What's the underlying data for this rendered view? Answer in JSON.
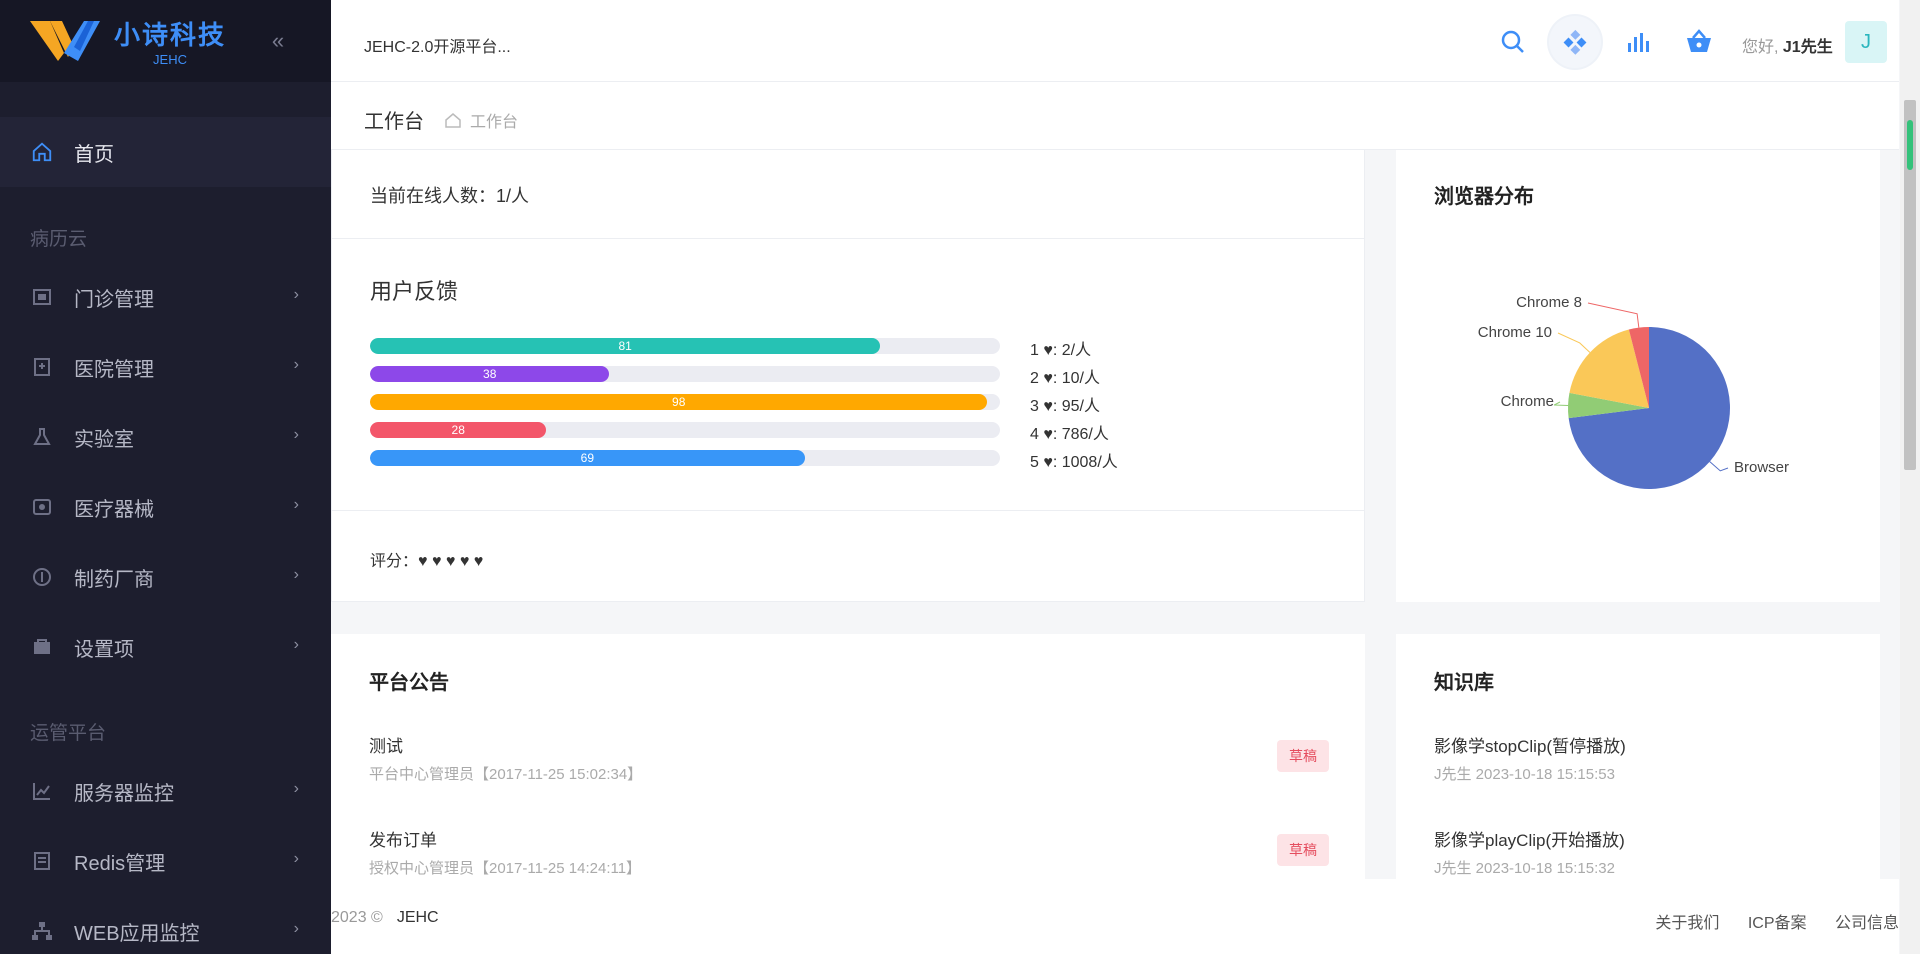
{
  "sidebar": {
    "brand_name": "小诗科技",
    "brand_sub": "JEHC",
    "home_label": "首页",
    "group1": "病历云",
    "group2": "运管平台",
    "items": [
      {
        "label": "门诊管理",
        "icon": "outpatient-icon"
      },
      {
        "label": "医院管理",
        "icon": "hospital-icon"
      },
      {
        "label": "实验室",
        "icon": "lab-icon"
      },
      {
        "label": "医疗器械",
        "icon": "device-icon"
      },
      {
        "label": "制药厂商",
        "icon": "pharma-icon"
      },
      {
        "label": "设置项",
        "icon": "settings-icon"
      },
      {
        "label": "服务器监控",
        "icon": "server-monitor-icon"
      },
      {
        "label": "Redis管理",
        "icon": "redis-icon"
      },
      {
        "label": "WEB应用监控",
        "icon": "web-monitor-icon"
      }
    ]
  },
  "header": {
    "title": "JEHC-2.0开源平台...",
    "greeting": "您好,",
    "user": "J1先生",
    "avatar_letter": "J"
  },
  "breadcrumb": {
    "page_title": "工作台",
    "crumb": "工作台"
  },
  "stats": {
    "online": "当前在线人数：1/人",
    "feedback_title": "用户反馈",
    "bars": [
      {
        "value": 81,
        "label": "1 ♥: 2/人",
        "color": "#26c2b4"
      },
      {
        "value": 38,
        "label": "2 ♥: 10/人",
        "color": "#8d48e9"
      },
      {
        "value": 98,
        "label": "3 ♥: 95/人",
        "color": "#ffa800"
      },
      {
        "value": 28,
        "label": "4 ♥: 786/人",
        "color": "#f3566a"
      },
      {
        "value": 69,
        "label": "5 ♥: 1008/人",
        "color": "#3896f8"
      }
    ],
    "rating": "评分：♥ ♥ ♥ ♥ ♥"
  },
  "browser_card": {
    "title": "浏览器分布"
  },
  "chart_data": {
    "type": "pie",
    "series": [
      {
        "name": "Browser",
        "value": 73,
        "color": "#5470c6"
      },
      {
        "name": "Chrome",
        "value": 5,
        "color": "#91cc75"
      },
      {
        "name": "Chrome 10",
        "value": 18,
        "color": "#fac858"
      },
      {
        "name": "Chrome 8",
        "value": 4,
        "color": "#ee6666"
      }
    ]
  },
  "notice": {
    "title": "平台公告",
    "items": [
      {
        "title": "测试",
        "meta": "平台中心管理员【2017-11-25 15:02:34】",
        "tag": "草稿"
      },
      {
        "title": "发布订单",
        "meta": "授权中心管理员【2017-11-25 14:24:11】",
        "tag": "草稿"
      }
    ]
  },
  "kb": {
    "title": "知识库",
    "items": [
      {
        "title": "影像学stopClip(暂停播放)",
        "meta": "J先生 2023-10-18 15:15:53"
      },
      {
        "title": "影像学playClip(开始播放)",
        "meta": "J先生 2023-10-18 15:15:32"
      }
    ]
  },
  "footer": {
    "copy": "2023 ©",
    "brand": "JEHC",
    "links": [
      "关于我们",
      "ICP备案",
      "公司信息"
    ]
  }
}
